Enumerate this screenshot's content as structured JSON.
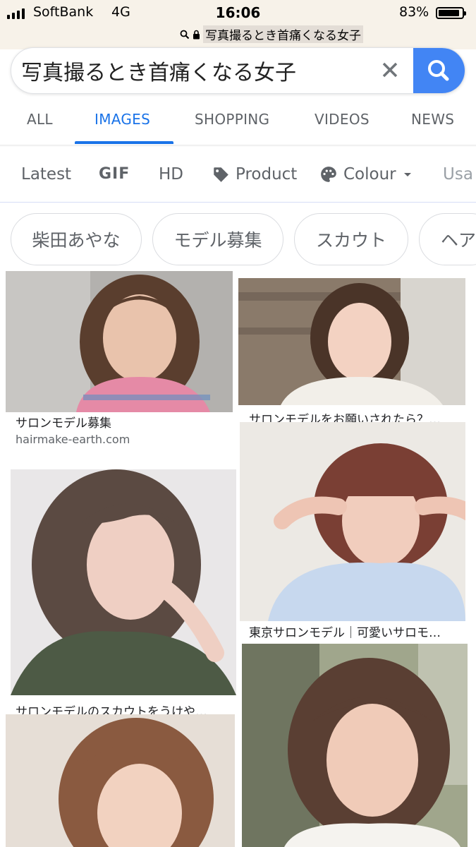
{
  "status_bar": {
    "carrier": "SoftBank",
    "network": "4G",
    "time": "16:06",
    "battery": "83%",
    "battery_level": 0.83,
    "url": "写真撮るとき首痛くなる女子"
  },
  "search": {
    "query": "写真撮るとき首痛くなる女子"
  },
  "tabs": [
    {
      "label": "ALL",
      "active": false
    },
    {
      "label": "IMAGES",
      "active": true
    },
    {
      "label": "SHOPPING",
      "active": false
    },
    {
      "label": "VIDEOS",
      "active": false
    },
    {
      "label": "NEWS",
      "active": false
    }
  ],
  "filters": [
    {
      "label": "Latest"
    },
    {
      "label": "GIF"
    },
    {
      "label": "HD"
    },
    {
      "label": "Product",
      "icon": "tag-icon"
    },
    {
      "label": "Colour",
      "icon": "palette-icon"
    },
    {
      "label": "Usa"
    }
  ],
  "chips": [
    "柴田あやな",
    "モデル募集",
    "スカウト",
    "ヘア"
  ],
  "results": [
    {
      "caption": "サロンモデル募集",
      "source": "hairmake-earth.com"
    },
    {
      "caption": "サロンモデルをお願いされたら？…"
    },
    {
      "caption": "東京サロンモデル｜可愛いサロモ…"
    },
    {
      "caption": "サロンモデルのスカウトをうけや…"
    },
    {
      "caption": ""
    },
    {
      "caption": ""
    }
  ],
  "colors": {
    "accent": "#1a73e8",
    "search_button": "#4285f4",
    "status_bar_bg": "#f7f2e9"
  }
}
